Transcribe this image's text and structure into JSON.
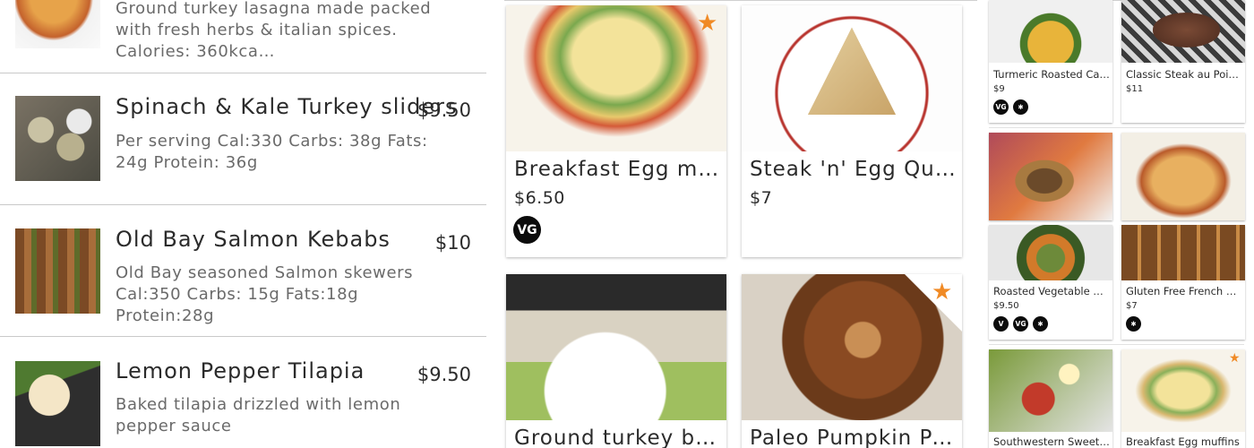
{
  "left_list": {
    "items": [
      {
        "title": "",
        "price": "",
        "description": "Ground turkey lasagna made packed with fresh herbs & italian spices. Calories: 360kca…",
        "photo": "lasagna"
      },
      {
        "title": "Spinach & Kale Turkey sliders",
        "price": "$9.50",
        "description": "Per serving Cal:330 Carbs: 38g Fats: 24g Protein: 36g",
        "photo": "sliders"
      },
      {
        "title": "Old Bay Salmon Kebabs",
        "price": "$10",
        "description": "Old Bay seasoned Salmon skewers Cal:350 Carbs: 15g Fats:18g Protein:28g",
        "photo": "kebab"
      },
      {
        "title": "Lemon Pepper Tilapia",
        "price": "$9.50",
        "description": "Baked tilapia drizzled with lemon pepper sauce",
        "photo": "tilapia"
      }
    ]
  },
  "cards": [
    {
      "title": "Breakfast Egg muffins",
      "price": "$6.50",
      "badges": [
        "VG"
      ],
      "starred": true,
      "photo": "eggmuffin"
    },
    {
      "title": "Steak 'n' Egg Quesadi…",
      "price": "$7",
      "badges": [],
      "starred": false,
      "photo": "quesadilla"
    },
    {
      "title": "Ground turkey breakf…",
      "price": "",
      "badges": [],
      "starred": false,
      "photo": "breakfast"
    },
    {
      "title": "Paleo Pumpkin Panc…",
      "price": "",
      "badges": [],
      "starred": true,
      "photo": "pancake"
    }
  ],
  "grid": [
    {
      "title": "Turmeric Roasted Ca…",
      "price": "$9",
      "badges": [
        "VG",
        "GF"
      ],
      "starred": false,
      "photo": "turmeric"
    },
    {
      "title": "Classic Steak au Poiv…",
      "price": "$11",
      "badges": [],
      "starred": false,
      "photo": "steak"
    },
    {
      "title": "",
      "price": "",
      "badges": [],
      "starred": false,
      "photo": "burger"
    },
    {
      "title": "",
      "price": "",
      "badges": [],
      "starred": false,
      "photo": "lasagna2"
    },
    {
      "title": "Roasted Vegetable B…",
      "price": "$9.50",
      "badges": [
        "V",
        "VG",
        "GF"
      ],
      "starred": false,
      "photo": "vegbowl"
    },
    {
      "title": "Gluten Free French T…",
      "price": "$7",
      "badges": [
        "GF"
      ],
      "starred": false,
      "photo": "frenchtoast"
    },
    {
      "title": "Southwestern Sweet …",
      "price": "",
      "badges": [],
      "starred": false,
      "photo": "southwest"
    },
    {
      "title": "Breakfast Egg muffins",
      "price": "",
      "badges": [],
      "starred": true,
      "photo": "eggmuffin2"
    }
  ],
  "icons": {
    "star": "star-icon",
    "vegetarian": "vg-badge-icon",
    "vegan": "v-badge-icon",
    "gluten_free": "gluten-free-icon"
  },
  "colors": {
    "accent_star": "#f08a25",
    "badge_bg": "#0c0c0c",
    "divider": "#c9c9c9"
  }
}
